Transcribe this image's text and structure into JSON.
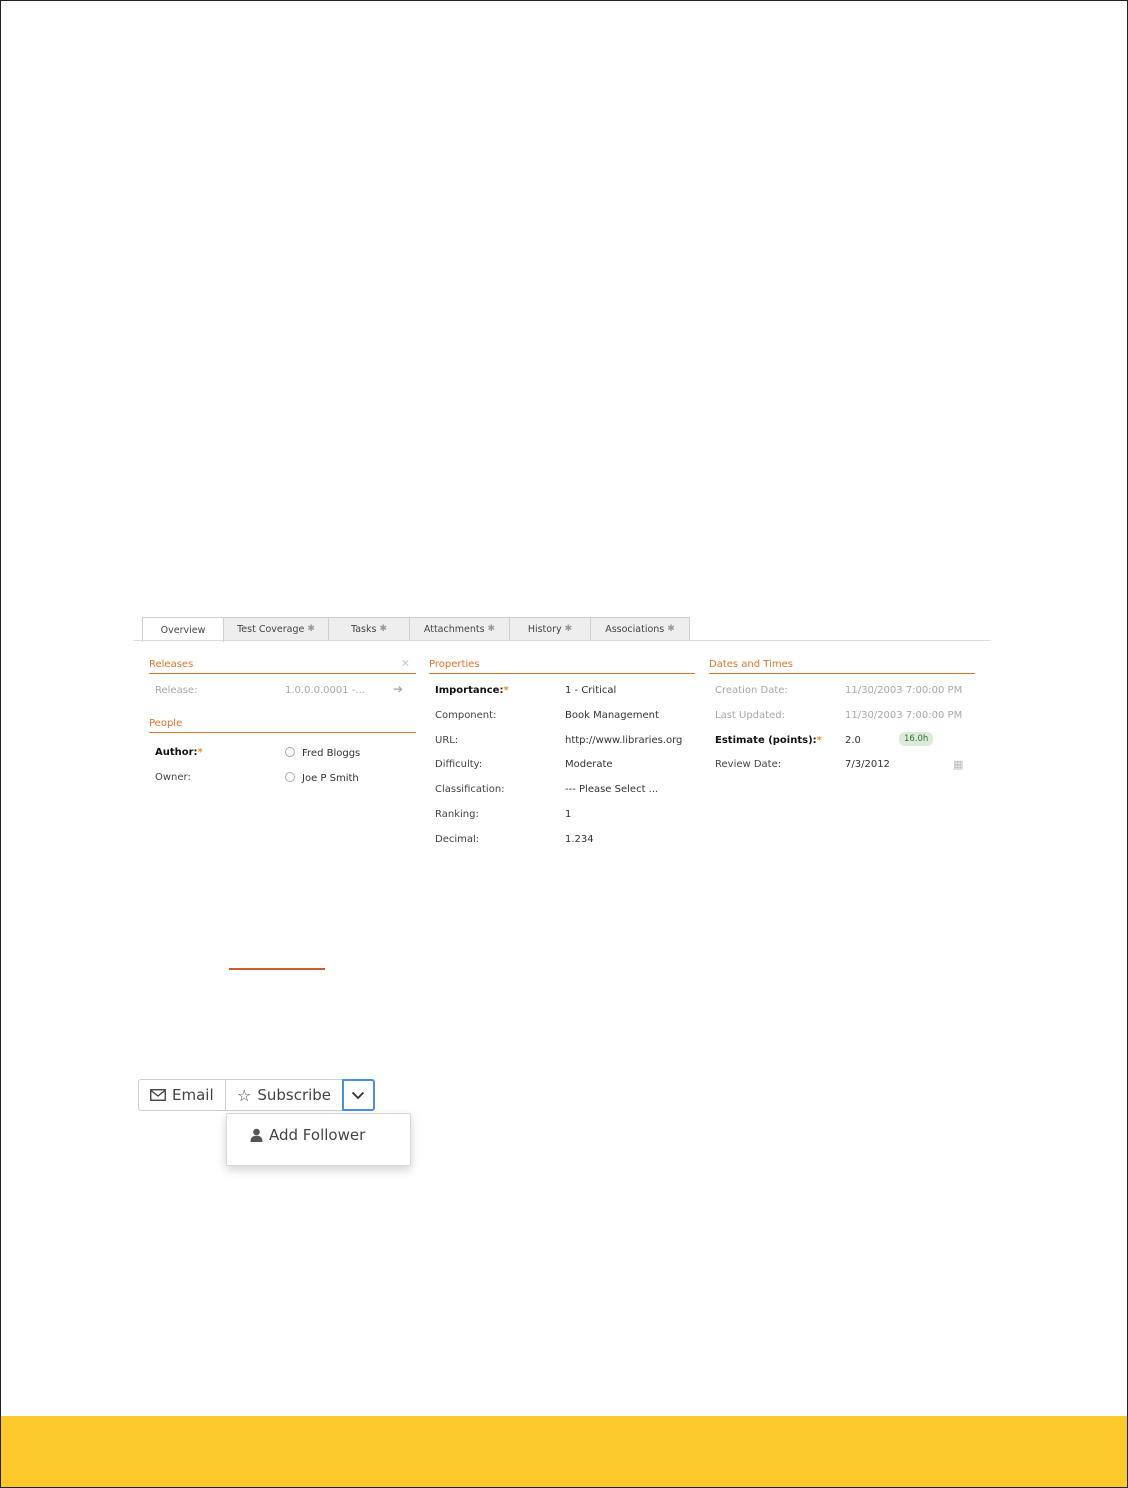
{
  "tabs": [
    {
      "label": "Overview",
      "active": true,
      "has_icon": false
    },
    {
      "label": "Test Coverage",
      "active": false,
      "has_icon": true
    },
    {
      "label": "Tasks",
      "active": false,
      "has_icon": true
    },
    {
      "label": "Attachments",
      "active": false,
      "has_icon": true
    },
    {
      "label": "History",
      "active": false,
      "has_icon": true
    },
    {
      "label": "Associations",
      "active": false,
      "has_icon": true
    }
  ],
  "releases": {
    "title": "Releases",
    "release_label": "Release:",
    "release_value": "1.0.0.0.0001 -..."
  },
  "people": {
    "title": "People",
    "author_label": "Author:",
    "author_value": "Fred Bloggs",
    "owner_label": "Owner:",
    "owner_value": "Joe P Smith"
  },
  "properties": {
    "title": "Properties",
    "fields": [
      {
        "label": "Importance:",
        "value": "1 - Critical",
        "required": true
      },
      {
        "label": "Component:",
        "value": "Book Management",
        "required": false
      },
      {
        "label": "URL:",
        "value": "http://www.libraries.org",
        "required": false
      },
      {
        "label": "Difficulty:",
        "value": "Moderate",
        "required": false
      },
      {
        "label": "Classification:",
        "value": "--- Please Select ...",
        "required": false
      },
      {
        "label": "Ranking:",
        "value": "1",
        "required": false
      },
      {
        "label": "Decimal:",
        "value": "1.234",
        "required": false
      }
    ]
  },
  "dates": {
    "title": "Dates and Times",
    "creation_label": "Creation Date:",
    "creation_value": "11/30/2003 7:00:00 PM",
    "updated_label": "Last Updated:",
    "updated_value": "11/30/2003 7:00:00 PM",
    "estimate_label": "Estimate (points):",
    "estimate_value": "2.0",
    "estimate_badge": "16.0h",
    "review_label": "Review Date:",
    "review_value": "7/3/2012"
  },
  "toolbar": {
    "email_label": "Email",
    "subscribe_label": "Subscribe",
    "add_follower_label": "Add Follower"
  },
  "colors": {
    "accent": "#e0752a",
    "footer": "#fcca2a",
    "toggle_border": "#4a90e2"
  }
}
